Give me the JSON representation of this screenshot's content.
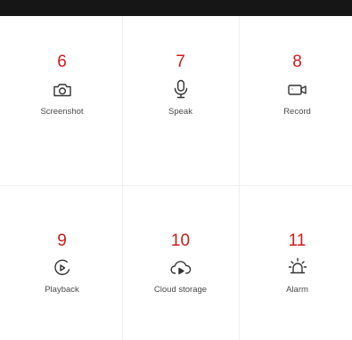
{
  "top_bar": {
    "color": "#161616"
  },
  "actions": [
    {
      "number": "6",
      "label": "Screenshot",
      "icon": "camera-icon"
    },
    {
      "number": "7",
      "label": "Speak",
      "icon": "microphone-icon"
    },
    {
      "number": "8",
      "label": "Record",
      "icon": "video-camera-icon"
    },
    {
      "number": "9",
      "label": "Playback",
      "icon": "playback-icon"
    },
    {
      "number": "10",
      "label": "Cloud storage",
      "icon": "cloud-play-icon"
    },
    {
      "number": "11",
      "label": "Alarm",
      "icon": "alarm-siren-icon"
    }
  ],
  "colors": {
    "number": "#d11a1a",
    "label": "#4a4a4a",
    "icon": "#333333",
    "divider": "#efefef"
  }
}
